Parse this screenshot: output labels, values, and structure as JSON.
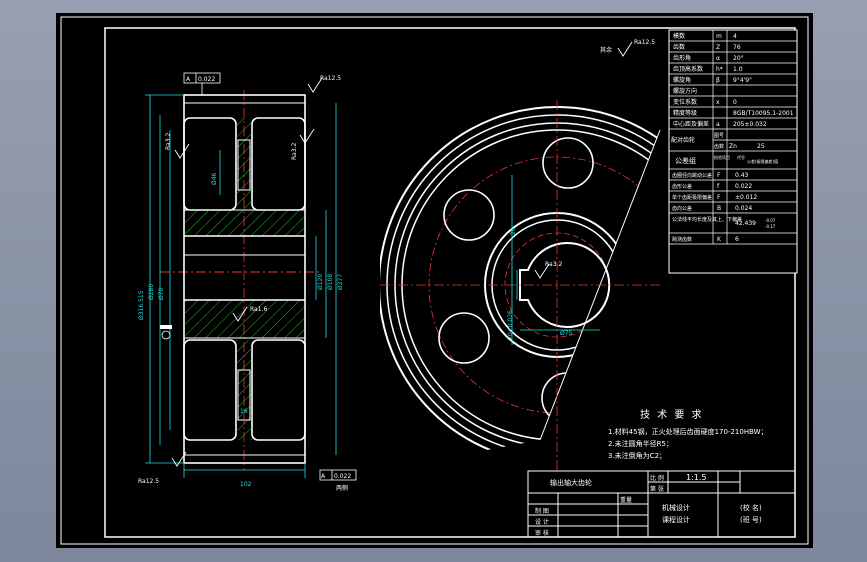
{
  "params": [
    {
      "name": "模数",
      "sym": "m",
      "val": "4"
    },
    {
      "name": "齿数",
      "sym": "Z",
      "val": "76"
    },
    {
      "name": "齿形角",
      "sym": "α",
      "val": "20°"
    },
    {
      "name": "齿顶高系数",
      "sym": "h*",
      "val": "1.0"
    },
    {
      "name": "螺旋角",
      "sym": "β",
      "val": "9°4'9\""
    },
    {
      "name": "螺旋方向",
      "sym": "",
      "val": ""
    },
    {
      "name": "变位系数",
      "sym": "x",
      "val": "0"
    },
    {
      "name": "精度等级",
      "sym": "",
      "val": "8GB/T10095.1-2001"
    },
    {
      "name": "中心距及偏差",
      "sym": "a",
      "val": "205±0.032"
    }
  ],
  "pair": {
    "label": "配对齿轮",
    "r1sym": "图号",
    "r2sym": "齿数",
    "r2key": "Zn",
    "r2val": "25"
  },
  "tol": {
    "label": "公差组",
    "sub": "检验项目",
    "code": "代号",
    "limit": "公差(极限偏差)值"
  },
  "params2": [
    {
      "name": "齿圈径向跳动公差",
      "sym": "F",
      "val": "0.43"
    },
    {
      "name": "齿形公差",
      "sym": "f",
      "val": "0.022"
    },
    {
      "name": "单个齿距极限偏差",
      "sym": "F",
      "val": "±0.012"
    },
    {
      "name": "齿向公差",
      "sym": "B",
      "val": "0.024"
    },
    {
      "name": "公法线平均长度及其上、下偏差",
      "sym": "",
      "val": "42.439",
      "dev1": "-0.07",
      "dev2": "-0.17"
    },
    {
      "name": "跨测齿数",
      "sym": "K",
      "val": "6"
    }
  ],
  "tech": {
    "title": "技 术 要 求",
    "items": [
      "1.材料45钢，正火处理后齿面硬度170-210HBW；",
      "2.未注圆角半径R5；",
      "3.未注倒角为C2；"
    ]
  },
  "title_block": {
    "name": "输出轴大齿轮",
    "scale_label": "比 例",
    "scale": "1:1.5",
    "sheet_label": "第 张",
    "weight_label": "重量",
    "drawn": "制 图",
    "designed": "设 计",
    "checked": "审 核",
    "course1": "机械设计",
    "course2": "课程设计",
    "school": "(校 名)",
    "class": "(班 号)"
  },
  "annot": {
    "rest": "其余",
    "r12_5": "Ra12.5",
    "r1_6": "Ra1.6",
    "r3_2": "Ra3.2",
    "tol1": "0.022",
    "tol2": "0.022",
    "datum": "A",
    "dim_width": "102",
    "dim_od": "Ø316.515",
    "dim_od_dev": "-0.1300",
    "dim_280": "Ø280",
    "dim_70": "Ø70",
    "dim_120": "Ø120",
    "dim_108": "Ø108",
    "dim_277": "Ø277",
    "dim_46": "Ø46",
    "dim_16": "16",
    "dim_20": "20",
    "dim_key": "20±0.026",
    "dim_bore": "Ø75",
    "ra_label": "两侧"
  }
}
